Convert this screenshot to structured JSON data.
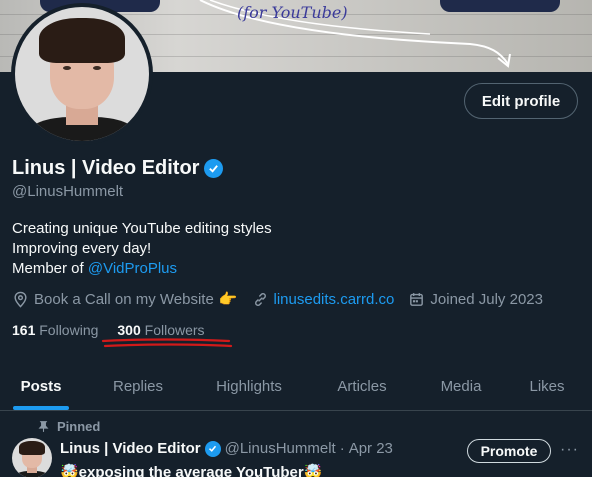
{
  "banner": {
    "tagline": "(for YouTube)"
  },
  "profile": {
    "display_name": "Linus | Video Editor",
    "handle": "@LinusHummelt",
    "edit_button": "Edit profile",
    "bio": {
      "line1": "Creating unique YouTube editing styles",
      "line2": "Improving every day!",
      "line3_prefix": "Member of ",
      "line3_link": "@VidProPlus"
    },
    "meta": {
      "website_label": "Book a Call on my Website",
      "website_emoji": "👉",
      "url": "linusedits.carrd.co",
      "joined": "Joined July 2023"
    },
    "stats": {
      "following_count": "161",
      "following_label": "Following",
      "followers_count": "300",
      "followers_label": "Followers"
    }
  },
  "tabs": [
    "Posts",
    "Replies",
    "Highlights",
    "Articles",
    "Media",
    "Likes"
  ],
  "active_tab": "Posts",
  "pinned_post": {
    "pinned_label": "Pinned",
    "author_name": "Linus | Video Editor",
    "author_handle": "@LinusHummelt",
    "separator": "·",
    "date": "Apr 23",
    "promote_label": "Promote",
    "more_label": "···",
    "text": "🤯exposing the average YouTuber🤯"
  },
  "colors": {
    "background": "#15202b",
    "accent": "#1d9bf0",
    "secondary_text": "#8b98a5",
    "annotation": "#d11a1a"
  }
}
